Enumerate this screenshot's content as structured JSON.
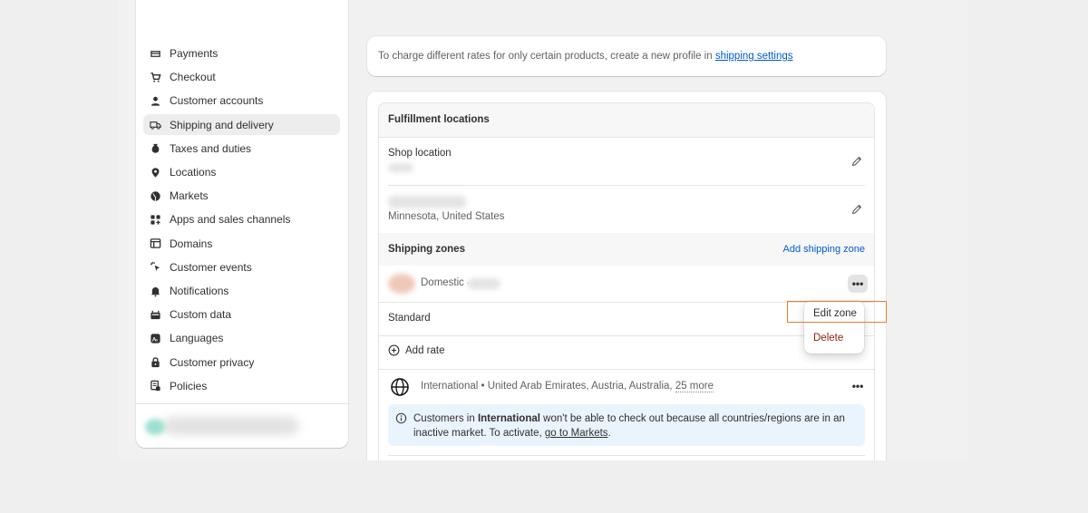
{
  "sidebar": {
    "items": [
      {
        "label": "Payments",
        "icon": "payments-icon",
        "active": false
      },
      {
        "label": "Checkout",
        "icon": "cart-icon",
        "active": false
      },
      {
        "label": "Customer accounts",
        "icon": "person-icon",
        "active": false
      },
      {
        "label": "Shipping and delivery",
        "icon": "truck-icon",
        "active": true
      },
      {
        "label": "Taxes and duties",
        "icon": "tax-icon",
        "active": false
      },
      {
        "label": "Locations",
        "icon": "location-pin-icon",
        "active": false
      },
      {
        "label": "Markets",
        "icon": "globe-icon",
        "active": false
      },
      {
        "label": "Apps and sales channels",
        "icon": "apps-icon",
        "active": false
      },
      {
        "label": "Domains",
        "icon": "domains-icon",
        "active": false
      },
      {
        "label": "Customer events",
        "icon": "cursor-click-icon",
        "active": false
      },
      {
        "label": "Notifications",
        "icon": "bell-icon",
        "active": false
      },
      {
        "label": "Custom data",
        "icon": "database-icon",
        "active": false
      },
      {
        "label": "Languages",
        "icon": "language-icon",
        "active": false
      },
      {
        "label": "Customer privacy",
        "icon": "lock-icon",
        "active": false
      },
      {
        "label": "Policies",
        "icon": "policy-icon",
        "active": false
      }
    ]
  },
  "top_card": {
    "text": "To charge different rates for only certain products, create a new profile in ",
    "link": "shipping settings"
  },
  "fulfillment": {
    "title": "Fulfillment locations",
    "location1_title": "Shop location",
    "location2_address": "Minnesota, United States"
  },
  "shipping_zones": {
    "title": "Shipping zones",
    "add_zone": "Add shipping zone",
    "domestic_label": "Domestic",
    "domestic_separator": "•",
    "rate_name": "Standard",
    "add_rate": "Add rate",
    "international_prefix": "International • United Arab Emirates, Austria, Australia, ",
    "international_more": "25 more",
    "more_dots": "•••"
  },
  "info": {
    "part1": "Customers in ",
    "bold": "International",
    "part2": " won't be able to check out because all countries/regions are in an inactive market. To activate, ",
    "link": "go to Markets",
    "part3": "."
  },
  "popover": {
    "edit": "Edit zone",
    "delete": "Delete"
  },
  "colors": {
    "link": "#005bd3",
    "delete": "#8e1f0b",
    "highlight": "#ef7a2f",
    "info_bg": "#eaf4ff"
  }
}
